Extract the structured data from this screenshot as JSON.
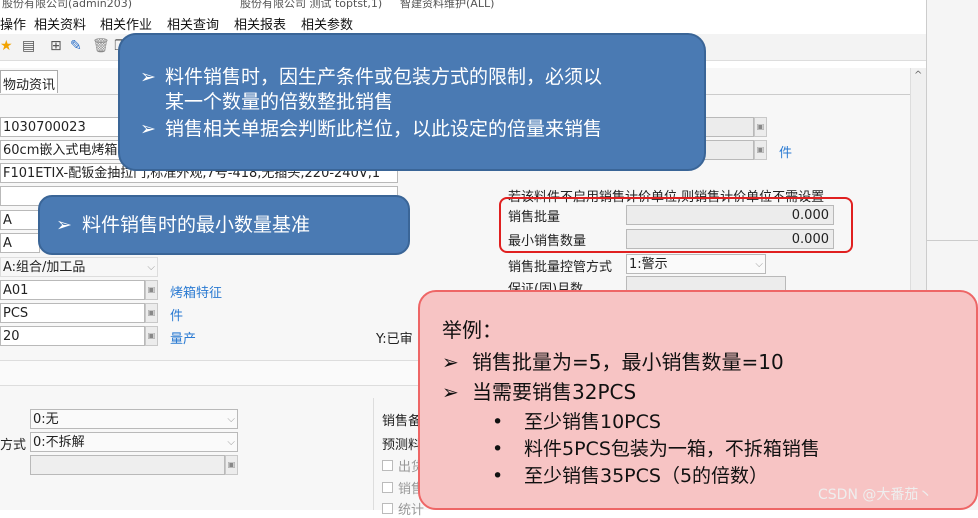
{
  "window": {
    "title_left": "股份有限公司(admin203)",
    "title_mid": "股份有限公司 测试 toptst,1)",
    "title_right": "智建资料维护(ALL)"
  },
  "menu": [
    "操作",
    "相关资料",
    "相关作业",
    "相关查询",
    "相关报表",
    "相关参数"
  ],
  "tab_label": "物动资讯",
  "form": {
    "item_no": "1030700023",
    "item_name": "60cm嵌入式电烤箱",
    "item_spec": "F101ETIX-配钣金抽拉门,标准外观,7号-418,无插头,220-240V,1",
    "code_a1": "A",
    "code_a2": "A",
    "item_type": "A:组合/加工品",
    "feature_code": "A01",
    "feature_label": "烤箱特征",
    "unit": "PCS",
    "unit_label": "件",
    "qty": "20",
    "qty_label": "量产",
    "status": "Y:已审",
    "right_label_jian": "件",
    "notice": "若该料件不启用销售计价单位,则销售计价单位不需设置",
    "sales_batch_label": "销售批量",
    "sales_batch_value": "0.000",
    "min_qty_label": "最小销售数量",
    "min_qty_value": "0.000",
    "batch_ctrl_label": "销售批量控管方式",
    "batch_ctrl_value": "1:警示",
    "warranty_label": "保证(固)月数",
    "opt1_value": "0:无",
    "split_label": "方式",
    "split_value": "0:不拆解",
    "sales_label": "销售备",
    "forecast_label": "预测料",
    "chk1": "出货",
    "chk2": "销售",
    "chk3": "统计"
  },
  "callouts": {
    "top_line1": "料件销售时，因生产条件或包装方式的限制，必须以",
    "top_line2": "某一个数量的倍数整批销售",
    "top_line3": "销售相关单据会判断此栏位，以此设定的倍量来销售",
    "left_line": "料件销售时的最小数量基准",
    "bullet": "➢"
  },
  "example": {
    "title": "举例：",
    "line1": "销售批量为=5，最小销售数量=10",
    "line2": "当需要销售32PCS",
    "sub1": "至少销售10PCS",
    "sub2": "料件5PCS包装为一箱，不拆箱销售",
    "sub3": "至少销售35PCS（5的倍数）",
    "dot": "•"
  },
  "watermark": "CSDN @大番茄丶",
  "colors": {
    "blue_callout": "#4a7ab3",
    "red_callout_bg": "#f7c4c4",
    "highlight": "#e02020",
    "link_blue": "#2a7ad2"
  }
}
